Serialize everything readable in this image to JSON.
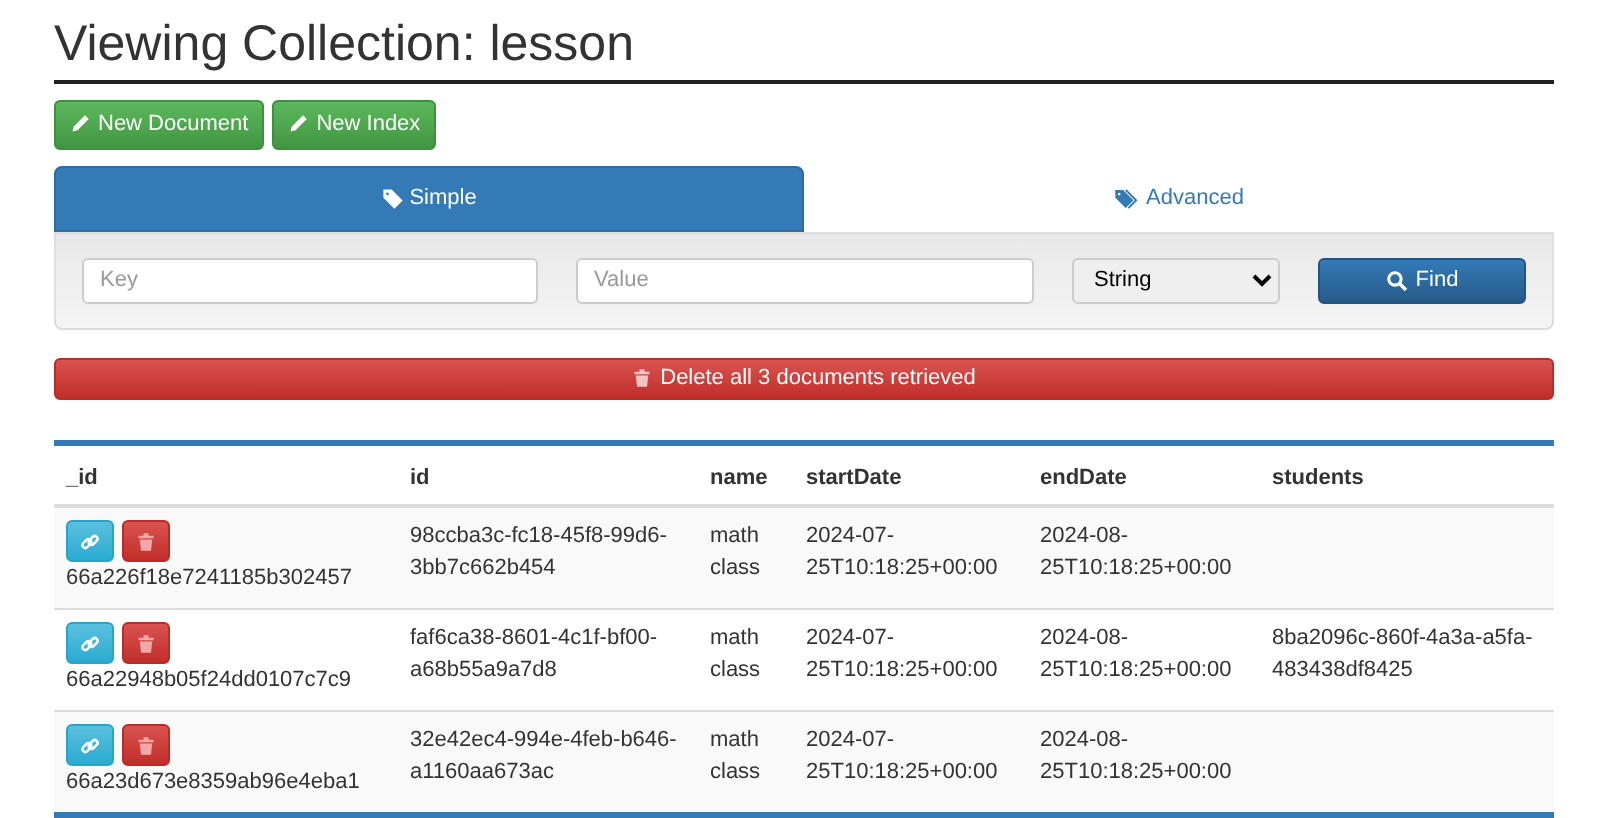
{
  "title": "Viewing Collection: lesson",
  "actions": [
    {
      "label": "New Document"
    },
    {
      "label": "New Index"
    }
  ],
  "tabs": [
    {
      "label": "Simple",
      "selected": true
    },
    {
      "label": "Advanced",
      "selected": false
    }
  ],
  "search": {
    "key_placeholder": "Key",
    "value_placeholder": "Value",
    "type": "String",
    "button": "Find"
  },
  "delete_button": "Delete all 3 documents retrieved",
  "table": {
    "columns": [
      "_id",
      "id",
      "name",
      "startDate",
      "endDate",
      "students"
    ],
    "rows": [
      {
        "cells": [
          "66a226f18e7241185b302457",
          "98ccba3c-fc18-45f8-99d6-3bb7c662b454",
          "math class",
          "2024-07-25T10:18:25+00:00",
          "2024-08-25T10:18:25+00:00",
          null
        ]
      },
      {
        "cells": [
          "66a22948b05f24dd0107c7c9",
          "faf6ca38-8601-4c1f-bf00-a68b55a9a7d8",
          "math class",
          "2024-07-25T10:18:25+00:00",
          "2024-08-25T10:18:25+00:00",
          "8ba2096c-860f-4a3a-a5fa-483438df8425"
        ]
      },
      {
        "cells": [
          "66a23d673e8359ab96e4eba1",
          "32e42ec4-994e-4feb-b646-a1160aa673ac",
          "math class",
          "2024-07-25T10:18:25+00:00",
          "2024-08-25T10:18:25+00:00",
          null
        ]
      }
    ]
  }
}
